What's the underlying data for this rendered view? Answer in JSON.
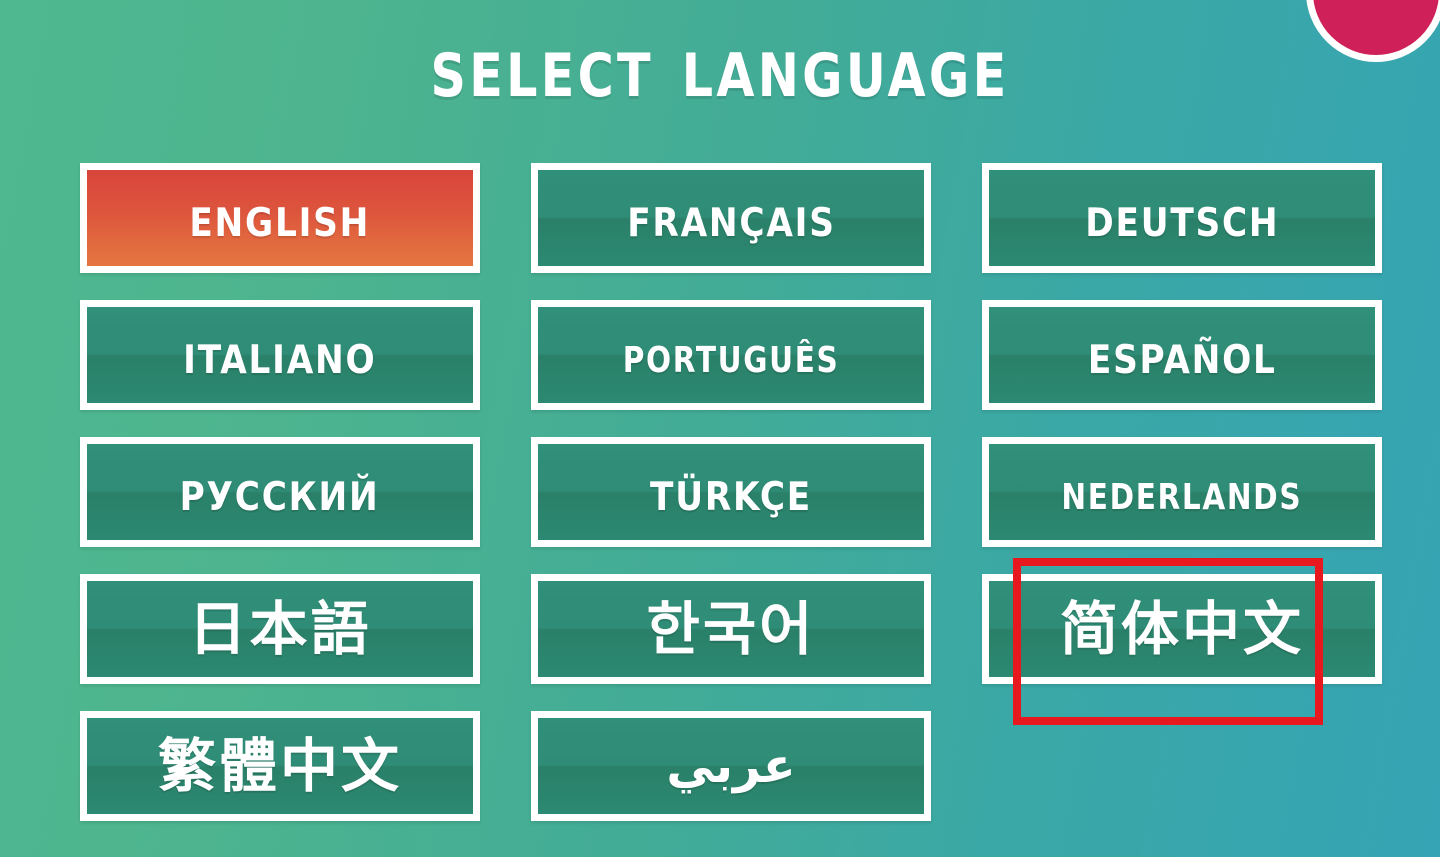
{
  "screen": {
    "title": "SELECT LANGUAGE",
    "background_gradient_from": "#4fb890",
    "background_gradient_to": "#37a5b3",
    "button_color": "#2e8a72",
    "selected_button_color": "#dd553d",
    "border_color": "#ffffff",
    "highlight_color": "#e8191e",
    "badge_color": "#cf2059"
  },
  "languages": [
    {
      "label": "English",
      "script": "latin",
      "selected": true,
      "highlighted": false
    },
    {
      "label": "Français",
      "script": "latin",
      "selected": false,
      "highlighted": false
    },
    {
      "label": "Deutsch",
      "script": "latin",
      "selected": false,
      "highlighted": false
    },
    {
      "label": "Italiano",
      "script": "latin",
      "selected": false,
      "highlighted": false
    },
    {
      "label": "Português",
      "script": "latin",
      "selected": false,
      "highlighted": false
    },
    {
      "label": "Español",
      "script": "latin",
      "selected": false,
      "highlighted": false
    },
    {
      "label": "Русский",
      "script": "latin",
      "selected": false,
      "highlighted": false
    },
    {
      "label": "Türkçe",
      "script": "latin",
      "selected": false,
      "highlighted": false
    },
    {
      "label": "Nederlands",
      "script": "latin",
      "selected": false,
      "highlighted": false
    },
    {
      "label": "日本語",
      "script": "cjk",
      "selected": false,
      "highlighted": false
    },
    {
      "label": "한국어",
      "script": "cjk",
      "selected": false,
      "highlighted": false
    },
    {
      "label": "简体中文",
      "script": "cjk",
      "selected": false,
      "highlighted": true
    },
    {
      "label": "繁體中文",
      "script": "cjk",
      "selected": false,
      "highlighted": false
    },
    {
      "label": "عربي",
      "script": "arabic",
      "selected": false,
      "highlighted": false
    }
  ]
}
